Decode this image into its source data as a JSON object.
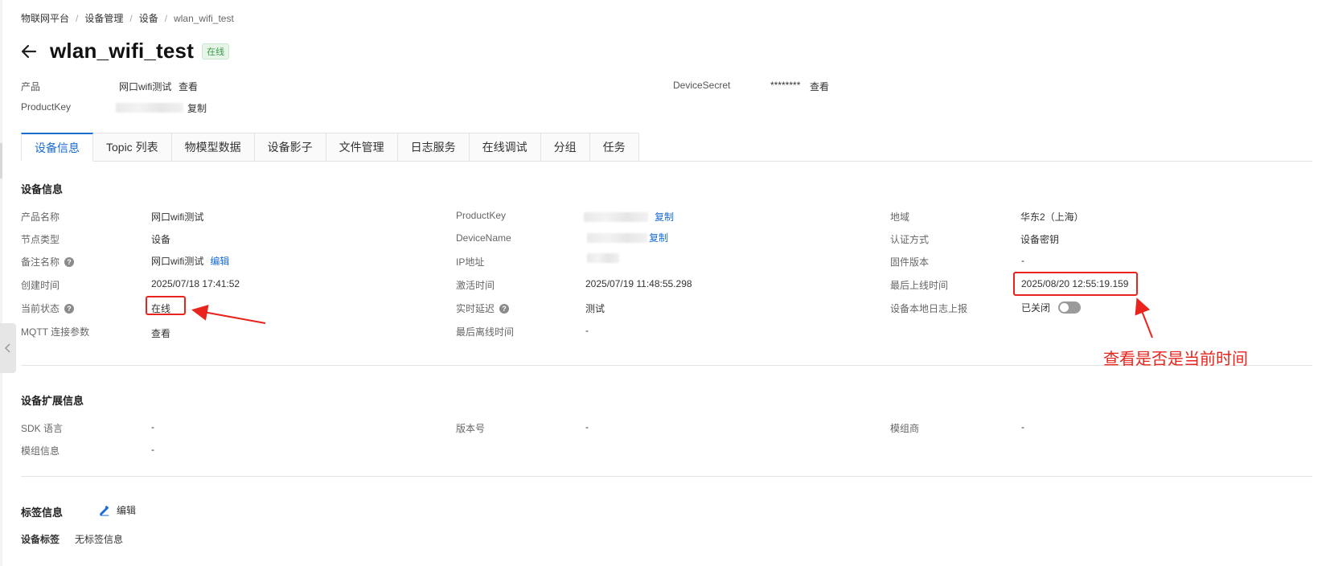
{
  "breadcrumb": [
    "物联网平台",
    "设备管理",
    "设备",
    "wlan_wifi_test"
  ],
  "device": {
    "name": "wlan_wifi_test",
    "status_tag": "在线"
  },
  "meta": {
    "product_label": "产品",
    "product_value": "网口wifi测试",
    "product_link": "查看",
    "productkey_label": "ProductKey",
    "productkey_link": "复制",
    "secret_label": "DeviceSecret",
    "secret_value": "********",
    "secret_link": "查看"
  },
  "tabs": [
    "设备信息",
    "Topic 列表",
    "物模型数据",
    "设备影子",
    "文件管理",
    "日志服务",
    "在线调试",
    "分组",
    "任务"
  ],
  "device_info": {
    "title": "设备信息",
    "col1": [
      {
        "k": "产品名称",
        "v": "网口wifi测试"
      },
      {
        "k": "节点类型",
        "v": "设备"
      },
      {
        "k": "备注名称",
        "v": "网口wifi测试",
        "link": "编辑"
      },
      {
        "k": "创建时间",
        "v": "2025/07/18 17:41:52"
      },
      {
        "k": "当前状态",
        "v": "在线"
      },
      {
        "k": "MQTT 连接参数",
        "link": "查看"
      }
    ],
    "col2": [
      {
        "k": "ProductKey",
        "link": "复制"
      },
      {
        "k": "DeviceName",
        "link": "复制"
      },
      {
        "k": "IP地址"
      },
      {
        "k": "激活时间",
        "v": "2025/07/19 11:48:55.298"
      },
      {
        "k": "实时延迟",
        "link": "测试"
      },
      {
        "k": "最后离线时间",
        "v": "-"
      }
    ],
    "col3": [
      {
        "k": "地域",
        "v": "华东2（上海）"
      },
      {
        "k": "认证方式",
        "v": "设备密钥"
      },
      {
        "k": "固件版本",
        "v": "-"
      },
      {
        "k": "最后上线时间",
        "v": "2025/08/20 12:55:19.159"
      },
      {
        "k": "设备本地日志上报",
        "v": "已关闭"
      }
    ]
  },
  "ext_info": {
    "title": "设备扩展信息",
    "items": [
      {
        "k": "SDK 语言",
        "v": "-"
      },
      {
        "k": "版本号",
        "v": "-"
      },
      {
        "k": "模组商",
        "v": "-"
      },
      {
        "k": "模组信息",
        "v": "-"
      }
    ]
  },
  "tag_info": {
    "title": "标签信息",
    "edit": "编辑",
    "label": "设备标签",
    "value": "无标签信息"
  },
  "annotation": {
    "text": "查看是否是当前时间",
    "color": "#e8241c"
  },
  "colors": {
    "link": "#1a6cd4",
    "accent": "#1a6cd4",
    "online_bg": "#e6f5e8",
    "online_text": "#3a9a48"
  }
}
